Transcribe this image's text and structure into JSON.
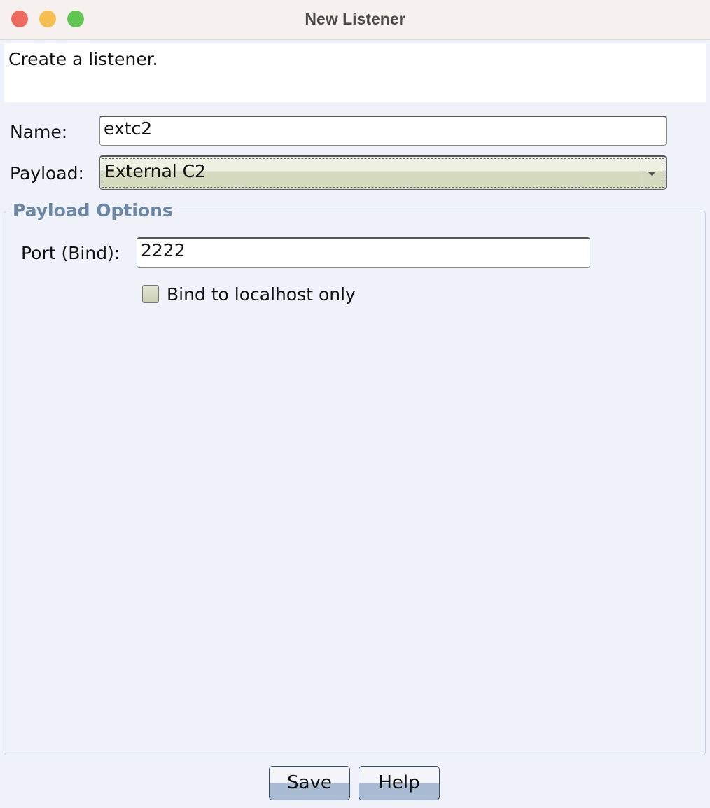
{
  "window": {
    "title": "New Listener",
    "traffic_lights": {
      "close": "#ec6a5e",
      "minimize": "#f4bf4f",
      "zoom": "#61c554"
    }
  },
  "description": "Create a listener.",
  "form": {
    "name_label": "Name:",
    "name_value": "extc2",
    "payload_label": "Payload:",
    "payload_value": "External C2"
  },
  "payload_options": {
    "title": "Payload Options",
    "port_label": "Port (Bind):",
    "port_value": "2222",
    "localhost_label": "Bind to localhost only",
    "localhost_checked": false
  },
  "buttons": {
    "save": "Save",
    "help": "Help"
  }
}
